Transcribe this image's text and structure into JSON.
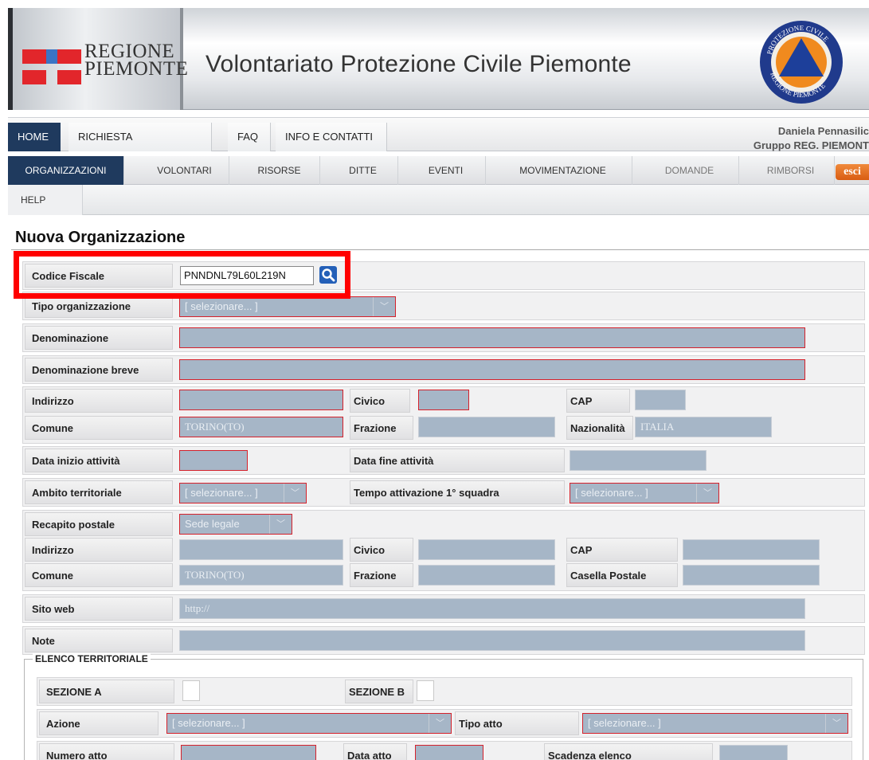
{
  "header": {
    "region_name": "REGIONE\nPIEMONTE",
    "site_title": "Volontariato Protezione Civile Piemonte",
    "emblem": {
      "top_text": "PROTEZIONE CIVILE",
      "bottom_text": "REGIONE PIEMONTE",
      "icon": "civil-protection-emblem"
    }
  },
  "nav_top": {
    "items": [
      "HOME",
      "RICHIESTA CREDENZIALI",
      "FAQ",
      "INFO E CONTATTI"
    ],
    "active": "HOME",
    "user_name": "Daniela Pennasilic",
    "user_group": "Gruppo REG. PIEMONT"
  },
  "nav_main": {
    "items": [
      "ORGANIZZAZIONI",
      "VOLONTARI",
      "RISORSE",
      "DITTE",
      "EVENTI",
      "MOVIMENTAZIONE",
      "DOMANDE",
      "RIMBORSI"
    ],
    "active": "ORGANIZZAZIONI",
    "logout": "esci",
    "help": "HELP"
  },
  "form": {
    "title": "Nuova Organizzazione",
    "codice_fiscale": {
      "label": "Codice Fiscale",
      "value": "PNNDNL79L60L219N"
    },
    "tipo_organizzazione": {
      "label": "Tipo organizzazione",
      "value": "[ selezionare... ]"
    },
    "denominazione": {
      "label": "Denominazione",
      "value": ""
    },
    "denominazione_breve": {
      "label": "Denominazione breve",
      "value": ""
    },
    "sede": {
      "indirizzo_label": "Indirizzo",
      "indirizzo": "",
      "civico_label": "Civico",
      "civico": "",
      "cap_label": "CAP",
      "cap": "",
      "comune_label": "Comune",
      "comune": "TORINO(TO)",
      "frazione_label": "Frazione",
      "frazione": "",
      "nazionalita_label": "Nazionalità",
      "nazionalita": "ITALIA"
    },
    "data_inizio": {
      "label": "Data inizio attività",
      "value": ""
    },
    "data_fine": {
      "label": "Data fine attività",
      "value": ""
    },
    "ambito": {
      "label": "Ambito territoriale",
      "value": "[ selezionare... ]"
    },
    "tempo_attivazione": {
      "label": "Tempo attivazione 1° squadra",
      "value": "[ selezionare... ]"
    },
    "recapito": {
      "label": "Recapito postale",
      "value": "Sede legale",
      "indirizzo_label": "Indirizzo",
      "indirizzo": "",
      "civico_label": "Civico",
      "civico": "",
      "cap_label": "CAP",
      "cap": "",
      "comune_label": "Comune",
      "comune": "TORINO(TO)",
      "frazione_label": "Frazione",
      "frazione": "",
      "casella_label": "Casella Postale",
      "casella": ""
    },
    "sito_web": {
      "label": "Sito web",
      "placeholder": "http://"
    },
    "note": {
      "label": "Note",
      "value": ""
    },
    "elenco": {
      "legend": "ELENCO TERRITORIALE",
      "sezione_a_label": "SEZIONE A",
      "sezione_b_label": "SEZIONE B",
      "azione_label": "Azione",
      "azione": "[ selezionare... ]",
      "tipo_atto_label": "Tipo atto",
      "tipo_atto": "[ selezionare... ]",
      "numero_atto_label": "Numero atto",
      "data_atto_label": "Data atto",
      "scadenza_label": "Scadenza elenco"
    }
  },
  "colors": {
    "nav_active": "#1f3a5e",
    "required_border": "#d5212b",
    "field_bg": "#a6b6c7",
    "highlight": "#ff0000",
    "logout": "#e0641c"
  }
}
